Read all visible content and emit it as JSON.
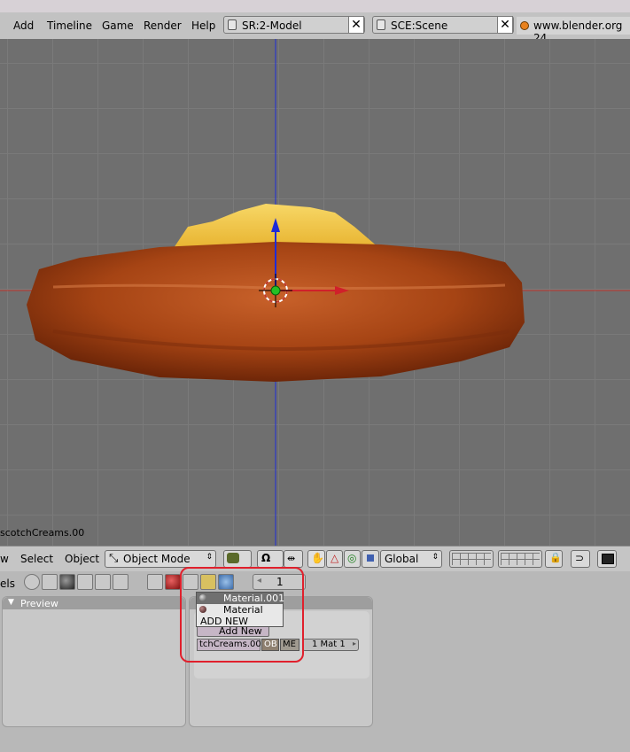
{
  "menubar": {
    "items": [
      "Add",
      "Timeline",
      "Game",
      "Render",
      "Help"
    ],
    "screen_field": "SR:2-Model",
    "scene_field": "SCE:Scene",
    "close_glyph": "✕",
    "site_link": "www.blender.org 24"
  },
  "viewport": {
    "object_label": "scotchCreams.00"
  },
  "header3d": {
    "view_menu": "w",
    "select_menu": "Select",
    "object_menu": "Object",
    "mode_select": "Object Mode",
    "orientation_select": "Global"
  },
  "buttons_header": {
    "panels_label": "els",
    "frame_value": "1"
  },
  "preview_panel": {
    "title": "Preview"
  },
  "material_popup": {
    "items": [
      "Material.001",
      "Material",
      "ADD NEW"
    ]
  },
  "link_panel": {
    "add_new_button": "Add New",
    "mesh_name": "tchCreams.00",
    "ob_toggle": "OB",
    "me_toggle": "ME",
    "mat_index": "1 Mat 1"
  },
  "colors": {
    "accent_highlight": "#e0202c",
    "viewport_bg": "#6f6f6f",
    "x_axis": "#d0202a",
    "y_axis": "#1d2bd8"
  }
}
